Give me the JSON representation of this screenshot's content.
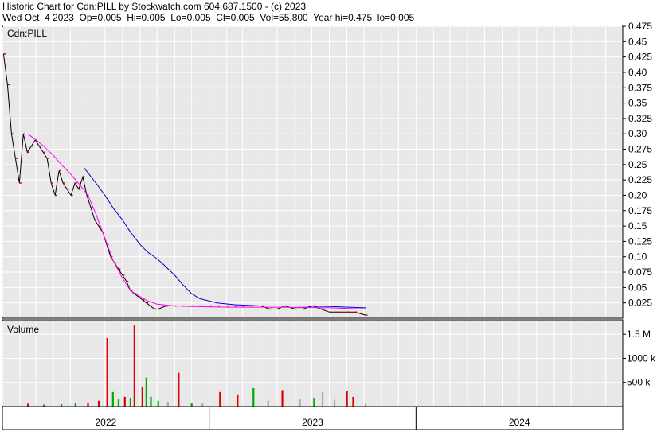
{
  "header": {
    "line1": "Historic Chart for Cdn:PILL by Stockwatch.com 604.687.1500 - (c) 2023",
    "line2": "Wed Oct  4 2023  Op=0.005  Hi=0.005  Lo=0.005  Cl=0.005  Vol=55,800  Year hi=0.475  lo=0.005"
  },
  "colors": {
    "background": "#ffffff",
    "plot_bg": "#e8e8e8",
    "grid": "#ffffff",
    "price": "#000000",
    "close_tick": "#cc0000",
    "ma_short": "#ff00ff",
    "ma_long": "#0000cc",
    "vol_up": "#00aa00",
    "vol_down": "#dd0000",
    "vol_flat": "#aaaaaa"
  },
  "chart_data": [
    {
      "type": "line",
      "panel": "price",
      "title": "Cdn:PILL",
      "ylim": [
        0,
        0.475
      ],
      "y_ticks": [
        "0.025",
        "0.05",
        "0.075",
        "0.10",
        "0.125",
        "0.15",
        "0.175",
        "0.20",
        "0.225",
        "0.25",
        "0.275",
        "0.30",
        "0.325",
        "0.35",
        "0.375",
        "0.40",
        "0.425",
        "0.45",
        "0.475"
      ],
      "x_labels": [
        "2022",
        "2023",
        "2024"
      ],
      "x_range": [
        "2022-01-01",
        "2024-12-31"
      ],
      "x_boundaries": [
        "2023-01-01",
        "2024-01-01"
      ],
      "grid": true,
      "series": [
        {
          "role": "close",
          "x": [
            "2022-01-03",
            "2022-01-10",
            "2022-01-17",
            "2022-01-24",
            "2022-01-31",
            "2022-02-07",
            "2022-02-14",
            "2022-02-21",
            "2022-02-28",
            "2022-03-07",
            "2022-03-14",
            "2022-03-21",
            "2022-03-28",
            "2022-04-04",
            "2022-04-11",
            "2022-04-18",
            "2022-04-25",
            "2022-05-02",
            "2022-05-09",
            "2022-05-16",
            "2022-05-23",
            "2022-05-30",
            "2022-06-06",
            "2022-06-13",
            "2022-06-20",
            "2022-06-27",
            "2022-07-04",
            "2022-07-11",
            "2022-07-18",
            "2022-07-25",
            "2022-08-01",
            "2022-08-08",
            "2022-08-15",
            "2022-08-22",
            "2022-08-29",
            "2022-09-05",
            "2022-09-12",
            "2022-09-19",
            "2022-09-26",
            "2022-10-03",
            "2022-10-17",
            "2022-11-01",
            "2022-11-15",
            "2022-12-01",
            "2022-12-15",
            "2023-01-02",
            "2023-01-16",
            "2023-02-01",
            "2023-02-15",
            "2023-03-01",
            "2023-03-15",
            "2023-04-03",
            "2023-04-17",
            "2023-05-01",
            "2023-05-15",
            "2023-06-01",
            "2023-06-15",
            "2023-07-03",
            "2023-07-17",
            "2023-08-01",
            "2023-08-15",
            "2023-09-01",
            "2023-09-15",
            "2023-10-04"
          ],
          "y": [
            0.43,
            0.38,
            0.3,
            0.26,
            0.22,
            0.3,
            0.27,
            0.28,
            0.29,
            0.28,
            0.27,
            0.26,
            0.22,
            0.2,
            0.24,
            0.22,
            0.21,
            0.2,
            0.22,
            0.21,
            0.23,
            0.2,
            0.18,
            0.16,
            0.15,
            0.14,
            0.12,
            0.1,
            0.09,
            0.08,
            0.07,
            0.06,
            0.045,
            0.04,
            0.035,
            0.03,
            0.025,
            0.02,
            0.015,
            0.015,
            0.02,
            0.02,
            0.02,
            0.02,
            0.02,
            0.02,
            0.02,
            0.02,
            0.02,
            0.02,
            0.02,
            0.02,
            0.015,
            0.015,
            0.02,
            0.015,
            0.015,
            0.02,
            0.015,
            0.01,
            0.01,
            0.01,
            0.01,
            0.005
          ]
        },
        {
          "role": "ma_short",
          "x": [
            "2022-02-15",
            "2022-03-01",
            "2022-03-15",
            "2022-04-01",
            "2022-04-15",
            "2022-05-01",
            "2022-05-15",
            "2022-06-01",
            "2022-06-15",
            "2022-07-01",
            "2022-07-15",
            "2022-08-01",
            "2022-08-15",
            "2022-09-01",
            "2022-09-15",
            "2022-10-01",
            "2022-11-01",
            "2022-12-01",
            "2023-02-01",
            "2023-05-01",
            "2023-08-01",
            "2023-10-04"
          ],
          "y": [
            0.3,
            0.29,
            0.28,
            0.265,
            0.25,
            0.235,
            0.22,
            0.2,
            0.17,
            0.13,
            0.095,
            0.065,
            0.045,
            0.035,
            0.028,
            0.023,
            0.02,
            0.019,
            0.018,
            0.018,
            0.017,
            0.015
          ]
        },
        {
          "role": "ma_long",
          "x": [
            "2022-05-25",
            "2022-06-15",
            "2022-07-01",
            "2022-07-15",
            "2022-08-01",
            "2022-08-15",
            "2022-09-01",
            "2022-09-15",
            "2022-10-01",
            "2022-10-15",
            "2022-11-01",
            "2022-11-15",
            "2022-12-01",
            "2022-12-15",
            "2023-01-15",
            "2023-02-15",
            "2023-04-01",
            "2023-06-01",
            "2023-08-01",
            "2023-10-04"
          ],
          "y": [
            0.245,
            0.22,
            0.2,
            0.18,
            0.16,
            0.14,
            0.12,
            0.107,
            0.097,
            0.085,
            0.07,
            0.055,
            0.04,
            0.032,
            0.025,
            0.022,
            0.02,
            0.02,
            0.019,
            0.017
          ]
        }
      ]
    },
    {
      "type": "bar",
      "panel": "volume",
      "title": "Volume",
      "ylim": [
        0,
        1800000
      ],
      "y_ticks": [
        "500 k",
        "1000 k",
        "1.5 M"
      ],
      "y_tick_values": [
        500000,
        1000000,
        1500000
      ],
      "x": [
        "2022-02-15",
        "2022-03-15",
        "2022-04-15",
        "2022-05-10",
        "2022-06-01",
        "2022-06-20",
        "2022-07-05",
        "2022-07-15",
        "2022-07-25",
        "2022-08-05",
        "2022-08-15",
        "2022-08-22",
        "2022-09-05",
        "2022-09-12",
        "2022-09-20",
        "2022-10-03",
        "2022-10-20",
        "2022-11-08",
        "2022-12-01",
        "2022-12-20",
        "2023-01-20",
        "2023-02-20",
        "2023-03-20",
        "2023-04-15",
        "2023-05-10",
        "2023-06-10",
        "2023-07-05",
        "2023-07-20",
        "2023-08-10",
        "2023-09-01",
        "2023-09-12",
        "2023-10-04"
      ],
      "values": [
        60000,
        40000,
        50000,
        80000,
        70000,
        120000,
        1420000,
        300000,
        150000,
        200000,
        180000,
        1700000,
        400000,
        600000,
        200000,
        120000,
        100000,
        700000,
        80000,
        60000,
        300000,
        250000,
        380000,
        120000,
        340000,
        150000,
        180000,
        300000,
        140000,
        320000,
        200000,
        55800
      ],
      "direction": [
        "down",
        "up",
        "up",
        "up",
        "down",
        "down",
        "down",
        "up",
        "up",
        "down",
        "up",
        "down",
        "down",
        "up",
        "up",
        "up",
        "flat",
        "down",
        "up",
        "flat",
        "down",
        "down",
        "up",
        "flat",
        "down",
        "flat",
        "up",
        "flat",
        "flat",
        "down",
        "down",
        "flat"
      ]
    }
  ]
}
